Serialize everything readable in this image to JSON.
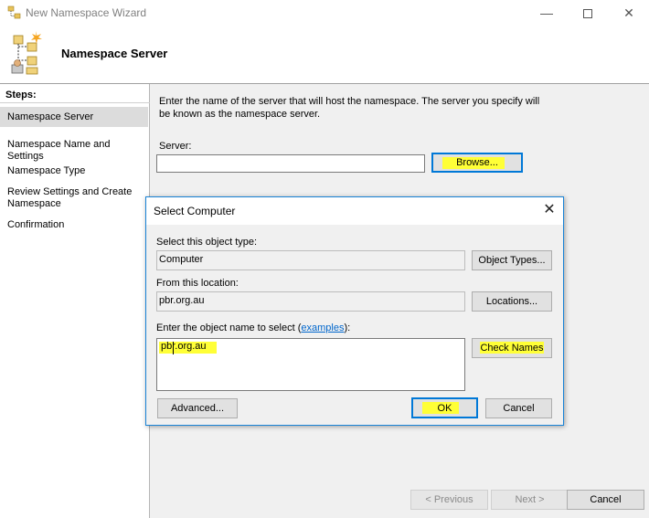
{
  "window": {
    "title": "New Namespace Wizard",
    "minimize_glyph": "—",
    "close_glyph": "✕"
  },
  "header": {
    "title": "Namespace Server"
  },
  "steps": {
    "title": "Steps:",
    "items": [
      {
        "label": "Namespace Server",
        "active": true
      },
      {
        "label": "Namespace Name and Settings",
        "active": false
      },
      {
        "label": "Namespace Type",
        "active": false
      },
      {
        "label": "Review Settings and Create Namespace",
        "active": false
      },
      {
        "label": "Confirmation",
        "active": false
      }
    ]
  },
  "main": {
    "description": "Enter the name of the server that will host the namespace. The server you specify will be known as the namespace server.",
    "server_label": "Server:",
    "server_value": "",
    "browse_label": "Browse..."
  },
  "footer": {
    "previous_label": "< Previous",
    "next_label": "Next >",
    "cancel_label": "Cancel"
  },
  "dialog": {
    "title": "Select Computer",
    "close_glyph": "✕",
    "object_type_label": "Select this object type:",
    "object_type_value": "Computer",
    "object_types_button": "Object Types...",
    "location_label": "From this location:",
    "location_value": "pbr.org.au",
    "locations_button": "Locations...",
    "object_name_label_pre": "Enter the object name to select (",
    "object_name_link": "examples",
    "object_name_label_post": "):",
    "object_name_value": "pbr.org.au",
    "check_names_button": "Check Names",
    "advanced_button": "Advanced...",
    "ok_button": "OK",
    "cancel_button": "Cancel"
  },
  "colors": {
    "highlight": "#ffff37",
    "focus_border": "#0078d7",
    "link": "#0066cc"
  },
  "icons": [
    "namespace-wizard-app-icon",
    "namespace-server-header-icon",
    "close-icon",
    "minimize-icon",
    "maximize-icon"
  ]
}
